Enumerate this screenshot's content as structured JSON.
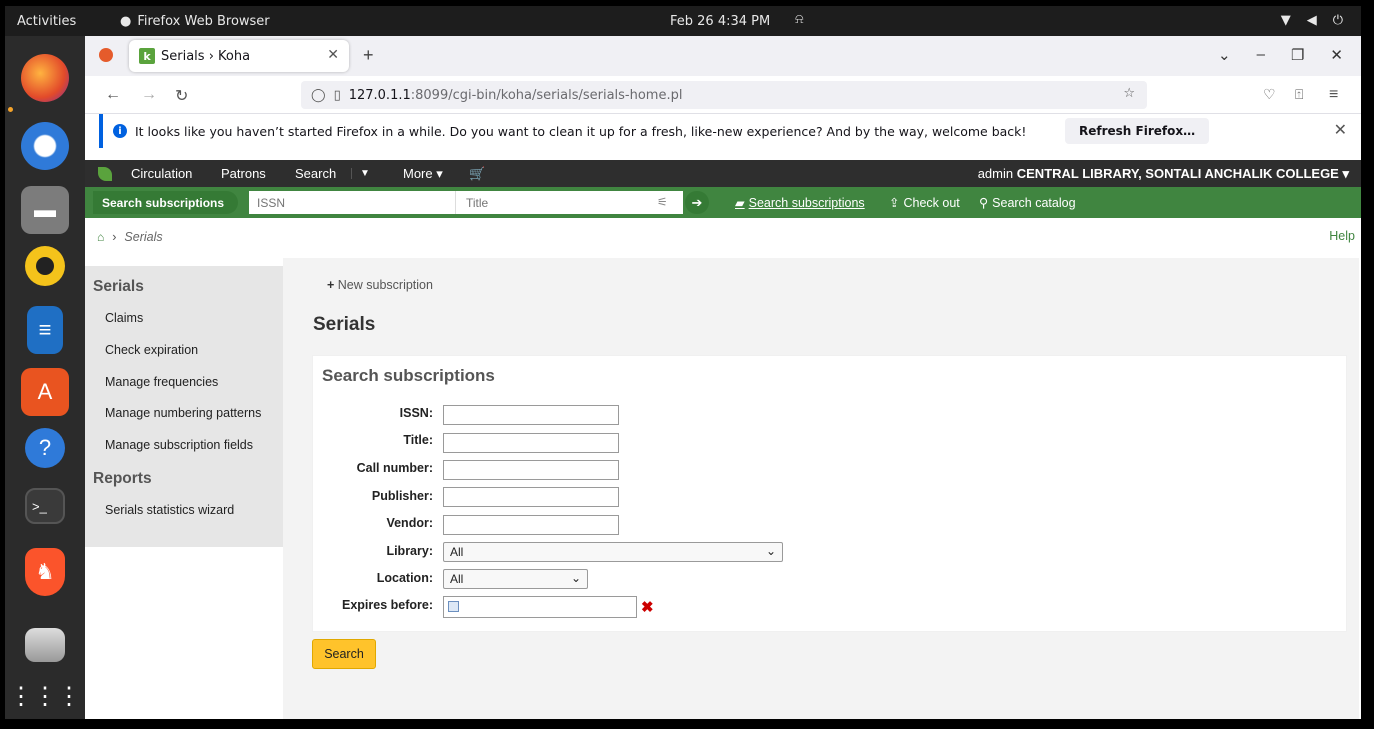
{
  "system": {
    "activities": "Activities",
    "app_name": "Firefox Web Browser",
    "clock": "Feb 26  4:34 PM"
  },
  "browser": {
    "tab_title": "Serials › Koha",
    "url_host": "127.0.1.1",
    "url_path": ":8099/cgi-bin/koha/serials/serials-home.pl",
    "infobar_text": "It looks like you haven’t started Firefox in a while. Do you want to clean it up for a fresh, like-new experience? And by the way, welcome back!",
    "refresh_label": "Refresh Firefox…"
  },
  "koha_nav": {
    "items": [
      "Circulation",
      "Patrons",
      "Search",
      "More ▾"
    ],
    "user": "admin",
    "library": "CENTRAL LIBRARY, SONTALI ANCHALIK COLLEGE ▾"
  },
  "search_bar": {
    "button_label": "Search subscriptions",
    "issn_placeholder": "ISSN",
    "title_placeholder": "Title",
    "links": [
      "Search subscriptions",
      "Check out",
      "Search catalog"
    ]
  },
  "breadcrumb": {
    "current": "Serials",
    "help": "Help"
  },
  "sidebar": {
    "serials_heading": "Serials",
    "serials_items": [
      "Claims",
      "Check expiration",
      "Manage frequencies",
      "Manage numbering patterns",
      "Manage subscription fields"
    ],
    "reports_heading": "Reports",
    "reports_items": [
      "Serials statistics wizard"
    ]
  },
  "main": {
    "new_subscription": "New subscription",
    "page_title": "Serials",
    "panel_title": "Search subscriptions",
    "fields": {
      "issn": "ISSN:",
      "title": "Title:",
      "callnumber": "Call number:",
      "publisher": "Publisher:",
      "vendor": "Vendor:",
      "library": "Library:",
      "location": "Location:",
      "expires": "Expires before:"
    },
    "library_value": "All",
    "location_value": "All",
    "search_button": "Search"
  }
}
